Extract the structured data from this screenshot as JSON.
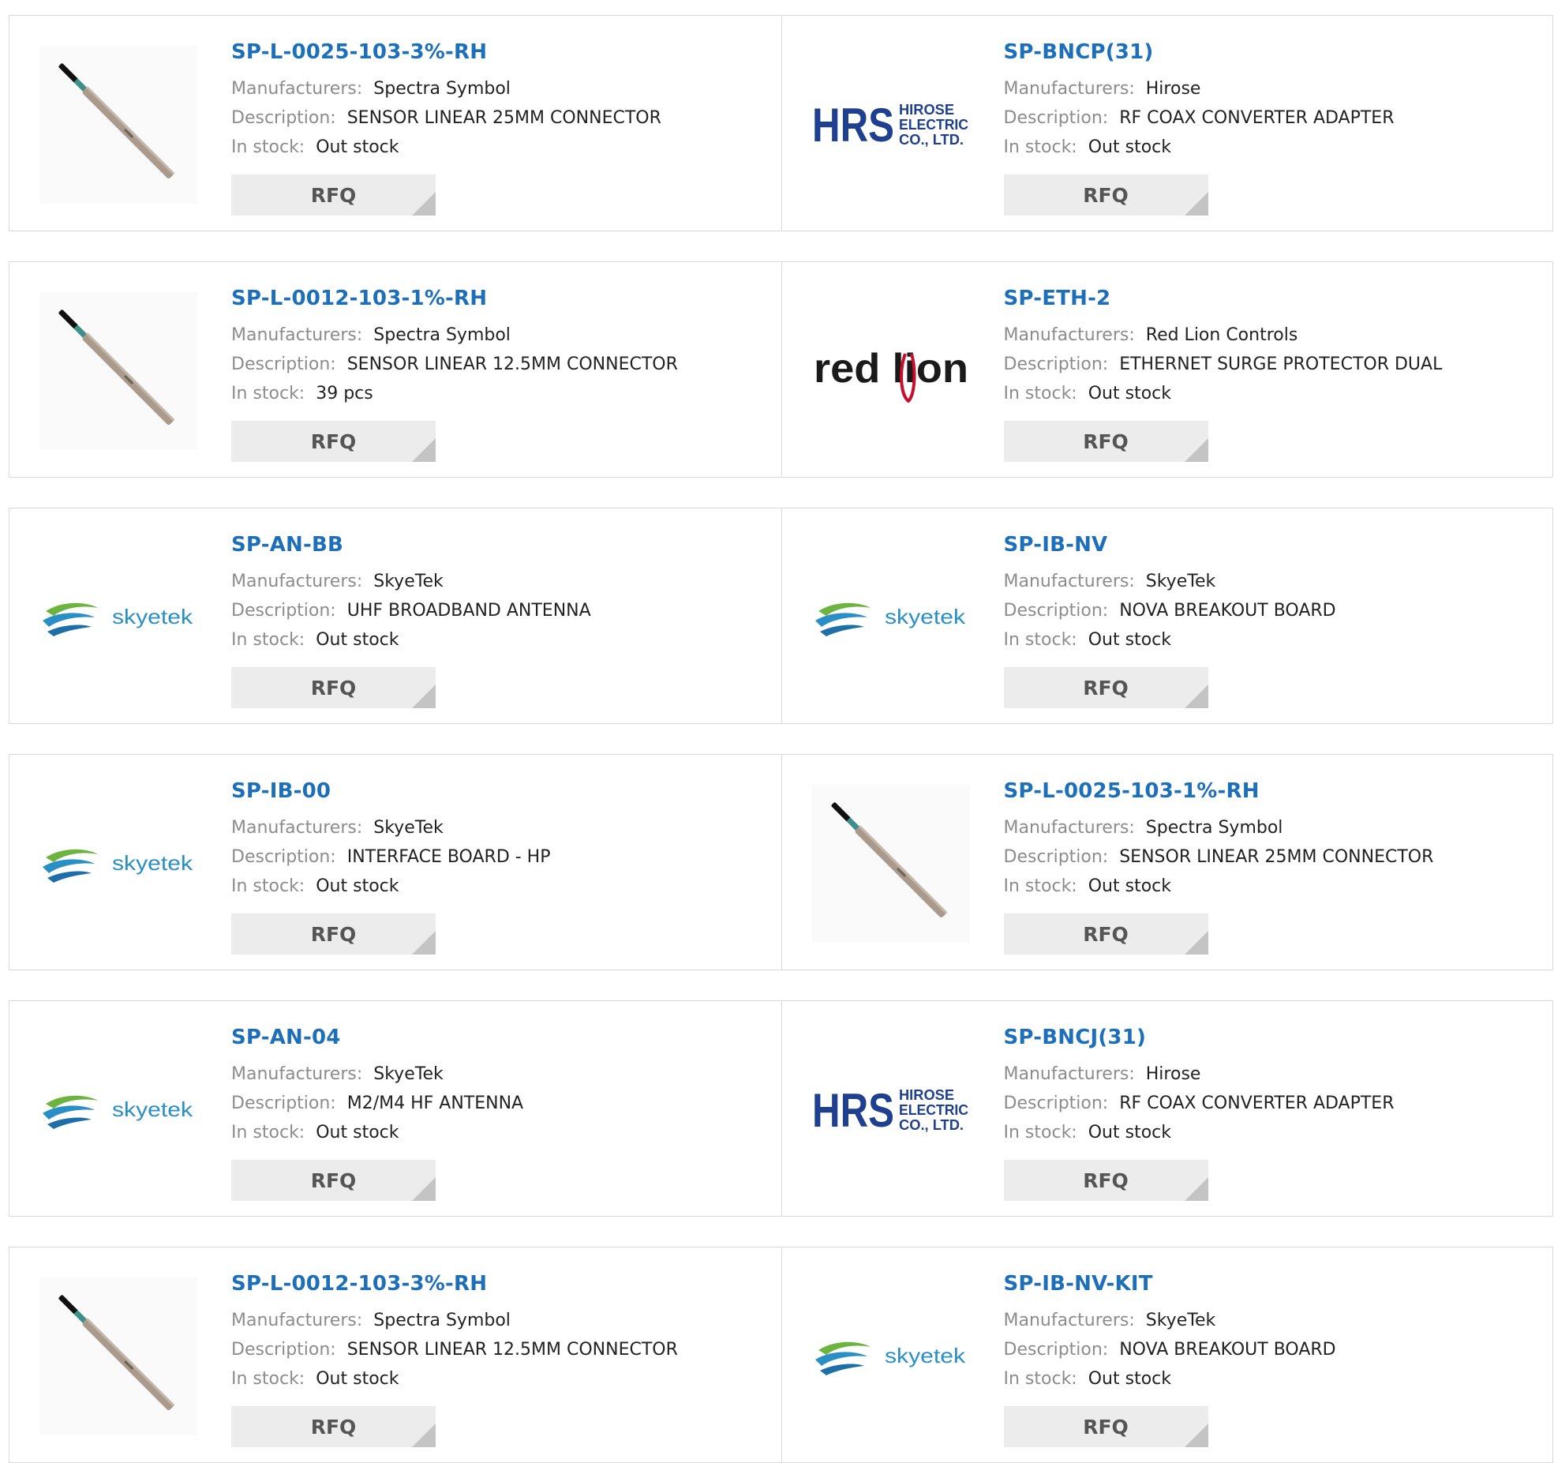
{
  "labels": {
    "manufacturers": "Manufacturers:",
    "description": "Description:",
    "in_stock": "In stock:",
    "rfq": "RFQ"
  },
  "products": [
    {
      "part": "SP-L-0025-103-3%-RH",
      "manufacturer": "Spectra Symbol",
      "description": "SENSOR LINEAR 25MM CONNECTOR",
      "stock": "Out stock",
      "image": "sensor-rod"
    },
    {
      "part": "SP-BNCP(31)",
      "manufacturer": "Hirose",
      "description": "RF COAX CONVERTER ADAPTER",
      "stock": "Out stock",
      "image": "hirose-logo"
    },
    {
      "part": "SP-L-0012-103-1%-RH",
      "manufacturer": "Spectra Symbol",
      "description": "SENSOR LINEAR 12.5MM CONNECTOR",
      "stock": "39 pcs",
      "image": "sensor-rod"
    },
    {
      "part": "SP-ETH-2",
      "manufacturer": "Red Lion Controls",
      "description": "ETHERNET SURGE PROTECTOR DUAL",
      "stock": "Out stock",
      "image": "redlion-logo"
    },
    {
      "part": "SP-AN-BB",
      "manufacturer": "SkyeTek",
      "description": "UHF BROADBAND ANTENNA",
      "stock": "Out stock",
      "image": "skyetek-logo"
    },
    {
      "part": "SP-IB-NV",
      "manufacturer": "SkyeTek",
      "description": "NOVA BREAKOUT BOARD",
      "stock": "Out stock",
      "image": "skyetek-logo"
    },
    {
      "part": "SP-IB-00",
      "manufacturer": "SkyeTek",
      "description": "INTERFACE BOARD - HP",
      "stock": "Out stock",
      "image": "skyetek-logo"
    },
    {
      "part": "SP-L-0025-103-1%-RH",
      "manufacturer": "Spectra Symbol",
      "description": "SENSOR LINEAR 25MM CONNECTOR",
      "stock": "Out stock",
      "image": "sensor-rod"
    },
    {
      "part": "SP-AN-04",
      "manufacturer": "SkyeTek",
      "description": "M2/M4 HF ANTENNA",
      "stock": "Out stock",
      "image": "skyetek-logo"
    },
    {
      "part": "SP-BNCJ(31)",
      "manufacturer": "Hirose",
      "description": "RF COAX CONVERTER ADAPTER",
      "stock": "Out stock",
      "image": "hirose-logo"
    },
    {
      "part": "SP-L-0012-103-3%-RH",
      "manufacturer": "Spectra Symbol",
      "description": "SENSOR LINEAR 12.5MM CONNECTOR",
      "stock": "Out stock",
      "image": "sensor-rod"
    },
    {
      "part": "SP-IB-NV-KIT",
      "manufacturer": "SkyeTek",
      "description": "NOVA BREAKOUT BOARD",
      "stock": "Out stock",
      "image": "skyetek-logo"
    }
  ],
  "logos": {
    "hirose": {
      "mark": "HRS",
      "line1": "HIROSE",
      "line2": "ELECTRIC",
      "line3": "CO., LTD."
    },
    "redlion": {
      "text": "red lion"
    },
    "skyetek": {
      "text": "skyetek"
    }
  },
  "colors": {
    "part_link": "#1c6fb8",
    "label": "#8c8c8c",
    "value": "#222222",
    "rfq_bg": "#ececec",
    "hirose_blue": "#1f3f8f",
    "redlion_red": "#c8102e",
    "skyetek_blue": "#2a8fc4",
    "skyetek_green": "#6cb33f"
  }
}
